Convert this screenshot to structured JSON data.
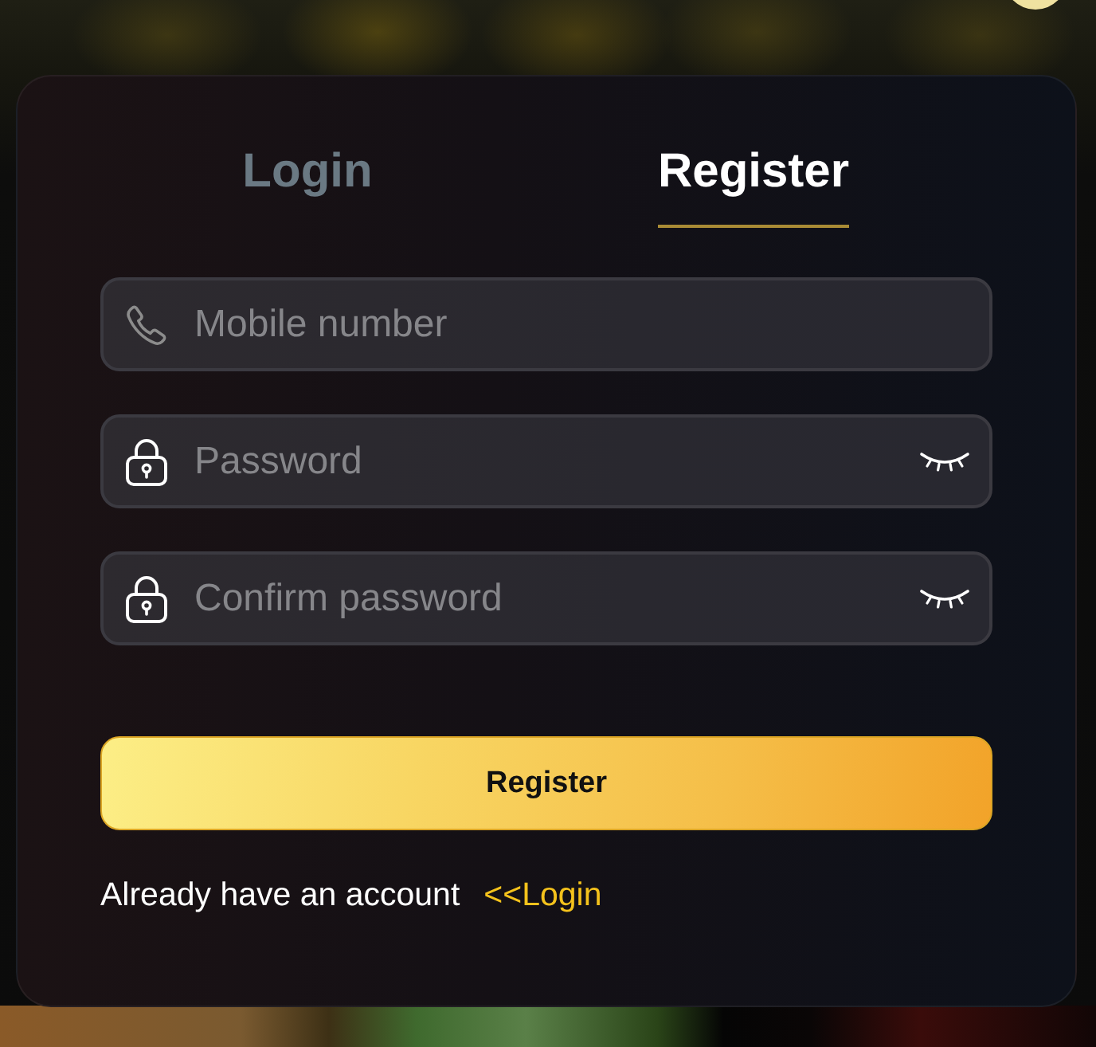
{
  "tabs": [
    {
      "label": "Login",
      "selected": false
    },
    {
      "label": "Register",
      "selected": true
    }
  ],
  "fields": [
    {
      "kind": "phone",
      "placeholder": "Mobile number"
    },
    {
      "kind": "password",
      "placeholder": "Password",
      "masked": true
    },
    {
      "kind": "password",
      "placeholder": "Confirm password",
      "masked": true
    }
  ],
  "submit_button": {
    "label": "Register"
  },
  "footer": {
    "text": "Already have an account",
    "link": "<<Login"
  }
}
